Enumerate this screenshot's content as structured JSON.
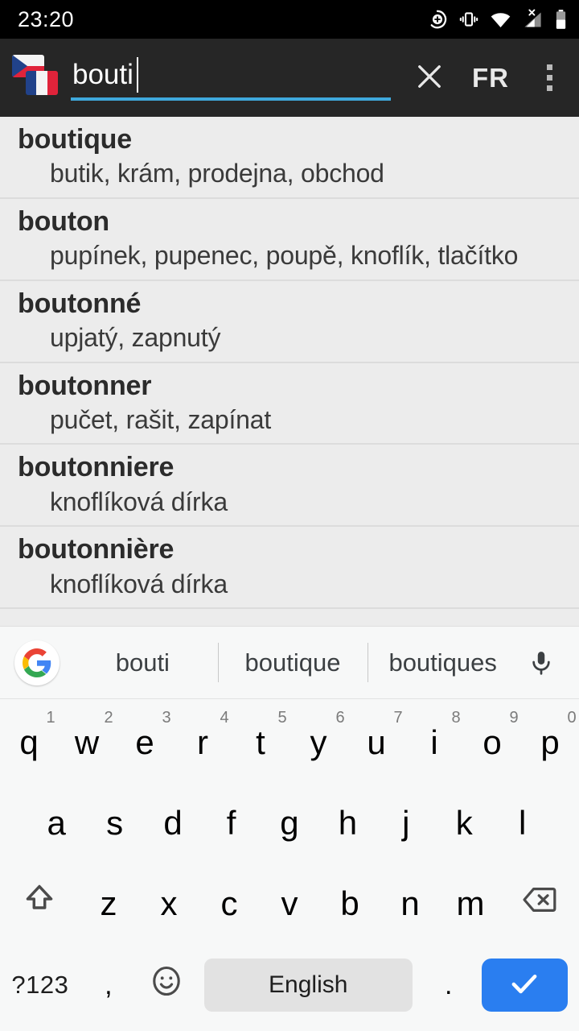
{
  "status_bar": {
    "time": "23:20",
    "icons": [
      "dnd-plus-icon",
      "vibrate-icon",
      "wifi-icon",
      "no-signal-icon",
      "battery-icon"
    ]
  },
  "toolbar": {
    "flag_icon": "czech-french-flags-icon",
    "search_value": "bouti",
    "search_placeholder": "",
    "clear_label": "clear-icon",
    "language_label": "FR",
    "overflow_label": "more-options-icon",
    "accent_color": "#3fa9dc",
    "background_color": "#262626"
  },
  "results": [
    {
      "term": "boutique",
      "definitions": "butik, krám, prodejna, obchod"
    },
    {
      "term": "bouton",
      "definitions": "pupínek, pupenec, poupě, knoflík, tlačítko"
    },
    {
      "term": "boutonné",
      "definitions": "upjatý, zapnutý"
    },
    {
      "term": "boutonner",
      "definitions": "pučet, rašit, zapínat"
    },
    {
      "term": "boutonniere",
      "definitions": "knoflíková dírka"
    },
    {
      "term": "boutonnière",
      "definitions": "knoflíková dírka"
    }
  ],
  "keyboard": {
    "logo": "google-logo-icon",
    "suggestions": [
      "bouti",
      "boutique",
      "boutiques"
    ],
    "mic_label": "microphone-icon",
    "row1": [
      {
        "key": "q",
        "hint": "1"
      },
      {
        "key": "w",
        "hint": "2"
      },
      {
        "key": "e",
        "hint": "3"
      },
      {
        "key": "r",
        "hint": "4"
      },
      {
        "key": "t",
        "hint": "5"
      },
      {
        "key": "y",
        "hint": "6"
      },
      {
        "key": "u",
        "hint": "7"
      },
      {
        "key": "i",
        "hint": "8"
      },
      {
        "key": "o",
        "hint": "9"
      },
      {
        "key": "p",
        "hint": "0"
      }
    ],
    "row2": [
      "a",
      "s",
      "d",
      "f",
      "g",
      "h",
      "j",
      "k",
      "l"
    ],
    "row3": [
      "z",
      "x",
      "c",
      "v",
      "b",
      "n",
      "m"
    ],
    "shift_label": "shift-icon",
    "backspace_label": "backspace-icon",
    "symbols_label": "?123",
    "comma_label": ",",
    "emoji_label": "emoji-icon",
    "space_label": "English",
    "period_label": ".",
    "enter_label": "check-icon",
    "enter_color": "#2a7ef0",
    "space_color": "#e2e2e2"
  }
}
